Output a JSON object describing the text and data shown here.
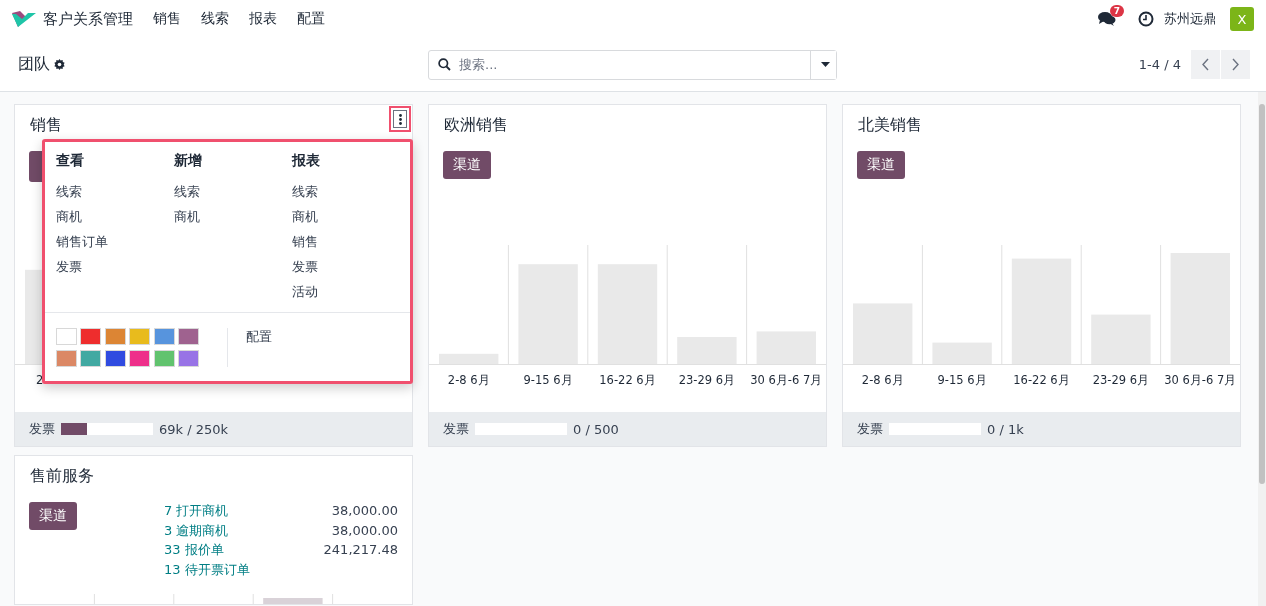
{
  "navbar": {
    "app_name": "客户关系管理",
    "menu": [
      "销售",
      "线索",
      "报表",
      "配置"
    ],
    "message_count": "7",
    "company": "苏州远鼎",
    "avatar_letter": "X"
  },
  "control_panel": {
    "title": "团队",
    "search": {
      "placeholder": "搜索..."
    },
    "pager": "1-4 / 4"
  },
  "teams": [
    {
      "name": "销售",
      "chart_labels": [
        "2"
      ],
      "footer": {
        "label": "发票",
        "level": 0.28,
        "value": "69k / 250k"
      },
      "card_menu": {
        "sections": [
          {
            "title": "查看",
            "items": [
              "线索",
              "商机",
              "销售订单",
              "发票"
            ]
          },
          {
            "title": "新增",
            "items": [
              "线索",
              "商机"
            ]
          },
          {
            "title": "报表",
            "items": [
              "线索",
              "商机",
              "销售",
              "发票",
              "活动"
            ]
          }
        ],
        "colors": [
          {
            "color": "#ffffff"
          },
          {
            "color": "#ee2d2d"
          },
          {
            "color": "#dc8534"
          },
          {
            "color": "#e8bb1d"
          },
          {
            "color": "#5794dd"
          },
          {
            "color": "#9f628f"
          },
          {
            "color": "#db8865"
          },
          {
            "color": "#41a9a2"
          },
          {
            "color": "#304be0"
          },
          {
            "color": "#ee2f8a"
          },
          {
            "color": "#61c36e"
          },
          {
            "color": "#9873e6"
          }
        ],
        "link": "配置"
      }
    },
    {
      "name": "欧洲销售",
      "button": "渠道",
      "chart_labels": [
        "2-8 6月",
        "9-15 6月",
        "16-22 6月",
        "23-29 6月",
        "30 6月-6 7月"
      ],
      "footer": {
        "label": "发票",
        "level": 0,
        "value": "0 / 500"
      }
    },
    {
      "name": "北美销售",
      "button": "渠道",
      "chart_labels": [
        "2-8 6月",
        "9-15 6月",
        "16-22 6月",
        "23-29 6月",
        "30 6月-6 7月"
      ],
      "footer": {
        "label": "发票",
        "level": 0,
        "value": "0 / 1k"
      }
    },
    {
      "name": "售前服务",
      "button": "渠道",
      "stats": [
        {
          "label": "7 打开商机",
          "amount": "38,000.00"
        },
        {
          "label": "3 逾期商机",
          "amount": "38,000.00"
        },
        {
          "label": "33 报价单",
          "amount": "241,217.48"
        },
        {
          "label": "13 待开票订单"
        }
      ]
    }
  ]
}
